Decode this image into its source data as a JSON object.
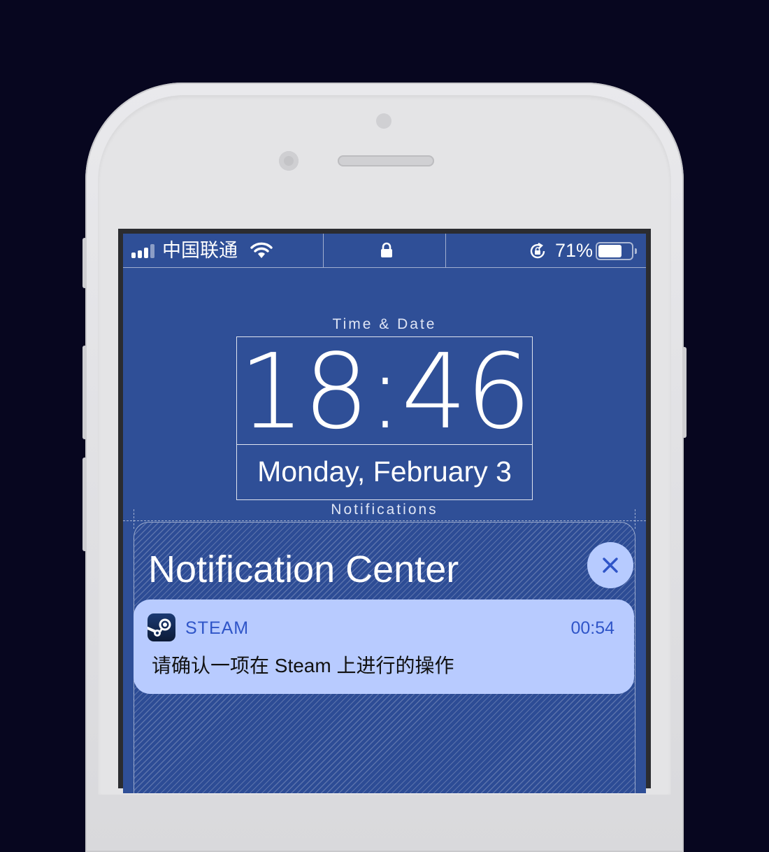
{
  "status_bar": {
    "carrier": "中国联通",
    "battery_percent": "71%",
    "battery_level": 0.71,
    "icons": [
      "signal-bars-icon",
      "wifi-icon",
      "lock-icon",
      "rotation-lock-icon",
      "battery-icon"
    ]
  },
  "lock_screen": {
    "time_section_label": "Time & Date",
    "time": "18:46",
    "date": "Monday, February 3",
    "notifications_section_label": "Notifications"
  },
  "notification_center": {
    "title": "Notification Center",
    "close_icon": "close-icon",
    "notification": {
      "app_name": "STEAM",
      "app_icon": "steam-icon",
      "time": "00:54",
      "message": "请确认一项在 Steam 上进行的操作"
    }
  },
  "colors": {
    "background": "#07061f",
    "screen": "#2f4f97",
    "card": "#b8cbff",
    "accent": "#2f55c8"
  }
}
